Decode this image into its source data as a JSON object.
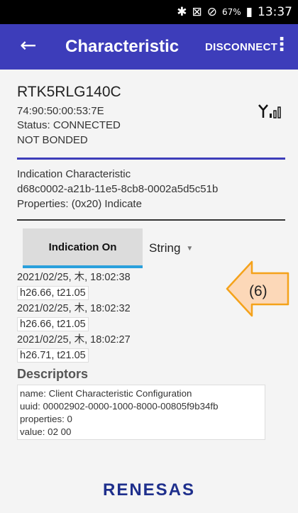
{
  "status_bar": {
    "bluetooth_icon": "bluetooth-icon",
    "signal_icon": "mute-icon",
    "dnd_icon": "do-not-disturb-icon",
    "battery_percent": "67%",
    "battery_icon": "battery-icon",
    "time": "13:37"
  },
  "app_bar": {
    "title": "Characteristic",
    "disconnect_label": "DISCONNECT",
    "background": "#3d3dba"
  },
  "device": {
    "name": "RTK5RLG140C",
    "address": "74:90:50:00:53:7E",
    "status": "Status:  CONNECTED",
    "bond": "NOT BONDED"
  },
  "characteristic": {
    "heading": "Indication Characteristic",
    "uuid": "d68c0002-a21b-11e5-8cb8-0002a5d5c51b",
    "properties": "Properties: (0x20) Indicate"
  },
  "controls": {
    "indication_button": "Indication On",
    "type_select": "String"
  },
  "log": [
    {
      "timestamp": "2021/02/25, 木, 18:02:38",
      "value": "h26.66, t21.05"
    },
    {
      "timestamp": "2021/02/25, 木, 18:02:32",
      "value": "h26.66, t21.05"
    },
    {
      "timestamp": "2021/02/25, 木, 18:02:27",
      "value": "h26.71, t21.05"
    }
  ],
  "callout": {
    "label": "(6)",
    "color": "#fcd8b8"
  },
  "descriptors": {
    "title": "Descriptors",
    "name": "name: Client Characteristic Configuration",
    "uuid": "uuid: 00002902-0000-1000-8000-00805f9b34fb",
    "properties": "properties: 0",
    "value": "value: 02 00"
  },
  "logo": "RENESAS"
}
